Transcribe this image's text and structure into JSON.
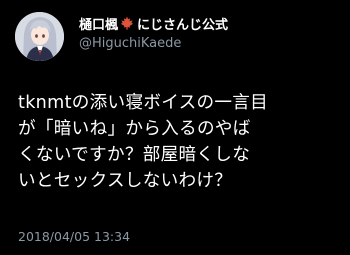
{
  "colors": {
    "background": "#000000",
    "primary_text": "#ffffff",
    "secondary_text": "#8b98a5",
    "maple_leaf": "#e0533b"
  },
  "author": {
    "name_prefix": "樋口楓",
    "name_emoji": "maple-leaf-icon",
    "name_suffix": "にじさんじ公式",
    "handle": "@HiguchiKaede",
    "avatar": "avatar-anime-girl"
  },
  "tweet": {
    "text_lines": [
      "tknmtの添い寝ボイスの一言目",
      "が「暗いね」から入るのやば",
      "くないですか？部屋暗くしな",
      "いとセックスしないわけ？"
    ],
    "timestamp": "2018/04/05 13:34"
  }
}
